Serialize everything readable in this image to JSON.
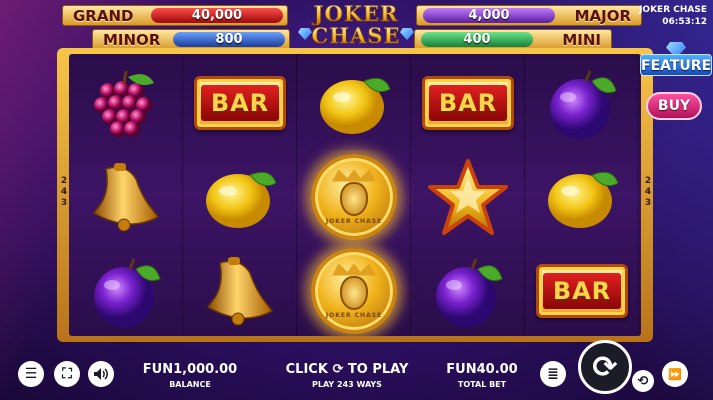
{
  "game": {
    "title": "JOKER CHASE",
    "clock": "06:53:12"
  },
  "logo": {
    "line1": "JOKER",
    "line2": "CHASE"
  },
  "jackpots": {
    "grand": {
      "label": "GRAND",
      "value": "40,000"
    },
    "major": {
      "label": "MAJOR",
      "value": "4,000"
    },
    "minor": {
      "label": "MINOR",
      "value": "800"
    },
    "mini": {
      "label": "MINI",
      "value": "400"
    }
  },
  "feature": {
    "label": "FEATURE",
    "buy_label": "BUY"
  },
  "ways_side": [
    "2",
    "4",
    "3"
  ],
  "reels": [
    [
      "grapes",
      "bell",
      "plum"
    ],
    [
      "bar",
      "lemon",
      "bell"
    ],
    [
      "lemon",
      "joker-coin",
      "joker-coin"
    ],
    [
      "bar",
      "star",
      "plum"
    ],
    [
      "plum",
      "lemon",
      "bar"
    ]
  ],
  "symbols": {
    "bar_text": "BAR",
    "coin_text": "JOKER CHASE"
  },
  "bottom": {
    "balance_value": "FUN1,000.00",
    "balance_label": "BALANCE",
    "click_text_pre": "CLICK",
    "click_text_post": "TO PLAY",
    "play_ways": "PLAY 243 WAYS",
    "total_bet_value": "FUN40.00",
    "total_bet_label": "TOTAL BET"
  },
  "icons": {
    "menu": "☰",
    "fullscreen": "⛶",
    "sound": "🔊",
    "bet": "≣",
    "spin": "⟳",
    "autoplay": "⟲",
    "turbo": "⏩",
    "click_spin": "⟳"
  },
  "colors": {
    "frame_gold": "#f7c548",
    "grand": "#c41a1a",
    "major": "#7a3ac8",
    "minor": "#2a5ad0",
    "mini": "#1e9a48",
    "buy": "#e0307a",
    "feature": "#2a6fe0"
  }
}
